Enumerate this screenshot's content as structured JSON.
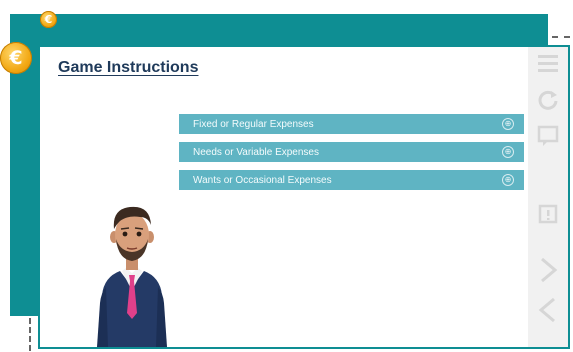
{
  "header": {
    "title": "Game Instructions"
  },
  "options": [
    {
      "label": "Fixed or Regular Expenses"
    },
    {
      "label": "Needs or Variable Expenses"
    },
    {
      "label": "Wants or Occasional Expenses"
    }
  ],
  "coins": {
    "symbol": "€"
  },
  "icons": {
    "option_expand": "⊕",
    "rail": [
      "menu-icon",
      "replay-icon",
      "transcript-icon",
      "notes-icon",
      "next-icon",
      "previous-icon"
    ]
  },
  "colors": {
    "teal": "#0e8e93",
    "option_bg": "#5fb4c3",
    "title": "#1f3a5a",
    "coin": "#f2a814"
  }
}
